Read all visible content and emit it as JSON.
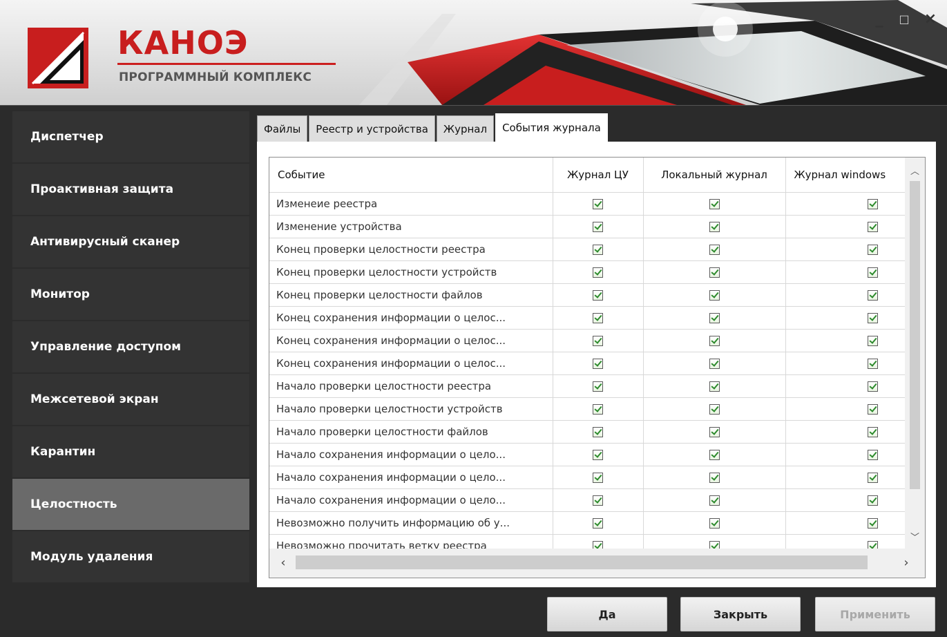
{
  "brand": {
    "name": "КАНОЭ",
    "subtitle": "ПРОГРАММНЫЙ КОМПЛЕКС"
  },
  "window_controls": {
    "minimize": "_",
    "maximize": "□",
    "close": "×"
  },
  "sidebar": {
    "items": [
      {
        "label": "Диспетчер"
      },
      {
        "label": "Проактивная защита"
      },
      {
        "label": "Антивирусный сканер"
      },
      {
        "label": "Монитор"
      },
      {
        "label": "Управление доступом"
      },
      {
        "label": "Межсетевой экран"
      },
      {
        "label": "Карантин"
      },
      {
        "label": "Целостность",
        "active": true
      },
      {
        "label": "Модуль удаления"
      }
    ]
  },
  "tabs": [
    {
      "label": "Файлы"
    },
    {
      "label": "Реестр и устройства"
    },
    {
      "label": "Журнал"
    },
    {
      "label": "События журнала",
      "active": true
    }
  ],
  "table": {
    "columns": [
      "Событие",
      "Журнал ЦУ",
      "Локальный журнал",
      "Журнал windows"
    ],
    "rows": [
      {
        "event": "Изменеие реестра",
        "cu": true,
        "local": true,
        "windows": true
      },
      {
        "event": "Изменение устройства",
        "cu": true,
        "local": true,
        "windows": true
      },
      {
        "event": "Конец проверки целостности реестра",
        "cu": true,
        "local": true,
        "windows": true
      },
      {
        "event": "Конец проверки целостности устройств",
        "cu": true,
        "local": true,
        "windows": true
      },
      {
        "event": "Конец проверки целостности файлов",
        "cu": true,
        "local": true,
        "windows": true
      },
      {
        "event": "Конец сохранения информации о целос...",
        "cu": true,
        "local": true,
        "windows": true
      },
      {
        "event": "Конец сохранения информации о целос...",
        "cu": true,
        "local": true,
        "windows": true
      },
      {
        "event": "Конец сохранения информации о целос...",
        "cu": true,
        "local": true,
        "windows": true
      },
      {
        "event": "Начало проверки целостности реестра",
        "cu": true,
        "local": true,
        "windows": true
      },
      {
        "event": "Начало проверки целостности устройств",
        "cu": true,
        "local": true,
        "windows": true
      },
      {
        "event": "Начало проверки целостности файлов",
        "cu": true,
        "local": true,
        "windows": true
      },
      {
        "event": "Начало сохранения информации о цело...",
        "cu": true,
        "local": true,
        "windows": true
      },
      {
        "event": "Начало сохранения информации о цело...",
        "cu": true,
        "local": true,
        "windows": true
      },
      {
        "event": "Начало сохранения информации о цело...",
        "cu": true,
        "local": true,
        "windows": true
      },
      {
        "event": "Невозможно получить информацию об у...",
        "cu": true,
        "local": true,
        "windows": true
      },
      {
        "event": "Невозможно прочитать ветку реестра",
        "cu": true,
        "local": true,
        "windows": true
      }
    ]
  },
  "buttons": {
    "ok": "Да",
    "close": "Закрыть",
    "apply": "Применить"
  },
  "colors": {
    "brand_red": "#c81e1e",
    "sidebar_bg": "#333333",
    "sidebar_active": "#6a6a6a",
    "check_green": "#2c8a2c"
  }
}
